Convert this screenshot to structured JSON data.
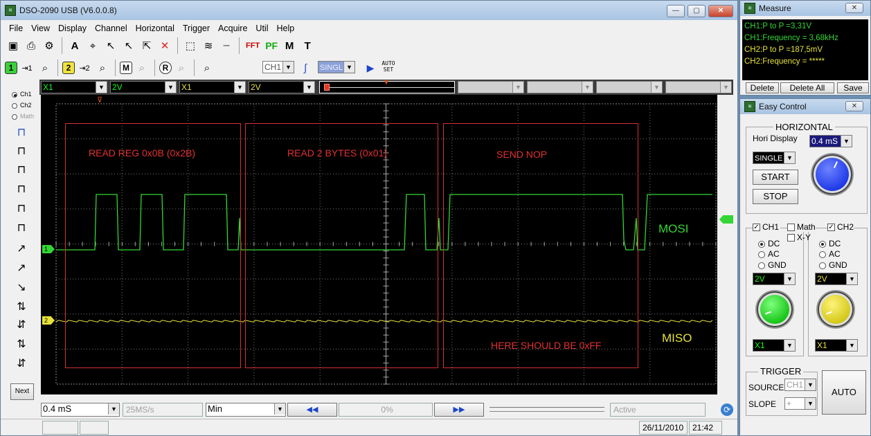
{
  "main_window": {
    "title": "DSO-2090 USB (V6.0.0.8)",
    "menu": [
      "File",
      "View",
      "Display",
      "Channel",
      "Horizontal",
      "Trigger",
      "Acquire",
      "Util",
      "Help"
    ],
    "toolbar2": {
      "ch1_chip": "1",
      "ch2_chip": "2",
      "math_chip": "M",
      "ref_chip": "R",
      "trigger_source": "CH1",
      "mode": "SINGLE",
      "autoset_label": "AUTO\nSET"
    },
    "channel_bar": {
      "ch1_probe": "X1",
      "ch1_volts": "2V",
      "ch2_probe": "X1",
      "ch2_volts": "2V"
    },
    "left_panel": {
      "ch1": "Ch1",
      "ch2": "Ch2",
      "math": "Math",
      "next": "Next"
    },
    "scope": {
      "boxes": [
        {
          "label": "READ REG 0x0B (0x2B)"
        },
        {
          "label": "READ 2 BYTES (0x01)"
        },
        {
          "label": "SEND NOP"
        }
      ],
      "note": "HERE SHOULD BE 0xFF",
      "mosi_label": "MOSI",
      "miso_label": "MISO",
      "ch1_marker": "1",
      "ch2_marker": "2",
      "trigger_marker": "T"
    },
    "bottom_bar": {
      "timebase": "0.4 mS",
      "sample_rate": "25MS/s",
      "measure_mode": "Min",
      "percent": "0%",
      "state": "Active",
      "date": "26/11/2010",
      "time": "21:42"
    }
  },
  "measure_window": {
    "title": "Measure",
    "lines": [
      "CH1:P to P =3,31V",
      "CH1:Frequency = 3,68kHz",
      "CH2:P to P =187,5mV",
      "CH2:Frequency = *****"
    ],
    "buttons": [
      "Delete",
      "Delete All",
      "Save"
    ]
  },
  "easy_control": {
    "title": "Easy Control",
    "horizontal": {
      "heading": "HORIZONTAL",
      "hori_display_label": "Hori Display",
      "timebase": "0.4 mS",
      "mode": "SINGLE",
      "start": "START",
      "stop": "STOP"
    },
    "channels": {
      "ch1_label": "CH1",
      "math_label": "Math",
      "xy_label": "X-Y",
      "ch2_label": "CH2",
      "coupling": [
        "DC",
        "AC",
        "GND"
      ],
      "ch1_volts": "2V",
      "ch2_volts": "2V",
      "ch1_probe": "X1",
      "ch2_probe": "X1"
    },
    "trigger": {
      "heading": "TRIGGER",
      "source_label": "SOURCE",
      "source": "CH1",
      "slope_label": "SLOPE",
      "slope": "+",
      "auto": "AUTO"
    }
  },
  "colors": {
    "ch1": "#33d633",
    "ch2": "#e6e23a",
    "annotation": "#e33030",
    "measure_text": "#e6e23a"
  }
}
